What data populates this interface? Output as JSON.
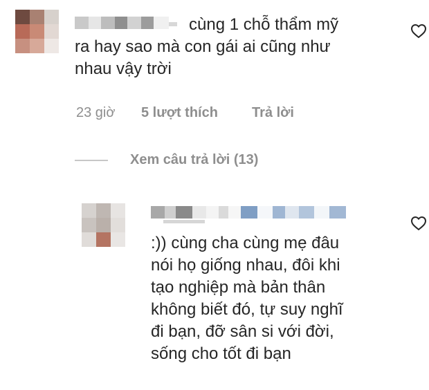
{
  "comments": [
    {
      "text_first_line": "cùng 1 chỗ thẩm mỹ",
      "text_rest": "ra hay sao mà con gái ai cũng như\nnhau vậy trời",
      "time": "23 giờ",
      "likes": "5 lượt thích",
      "reply_label": "Trả lời",
      "view_replies": "Xem câu trả lời (13)"
    },
    {
      "text": ":)) cùng cha cùng mẹ đâu\nnói họ giống nhau, đôi khi\ntạo nghiệp mà bản thân\nkhông biết đó, tự suy nghĩ\nđi bạn, đỡ sân si với đời,\nsống cho tốt đi bạn"
    }
  ],
  "icons": {
    "like": "heart-outline-icon"
  },
  "colors": {
    "text": "#262626",
    "muted": "#8e8e8e",
    "divider": "#c7c7c7"
  }
}
